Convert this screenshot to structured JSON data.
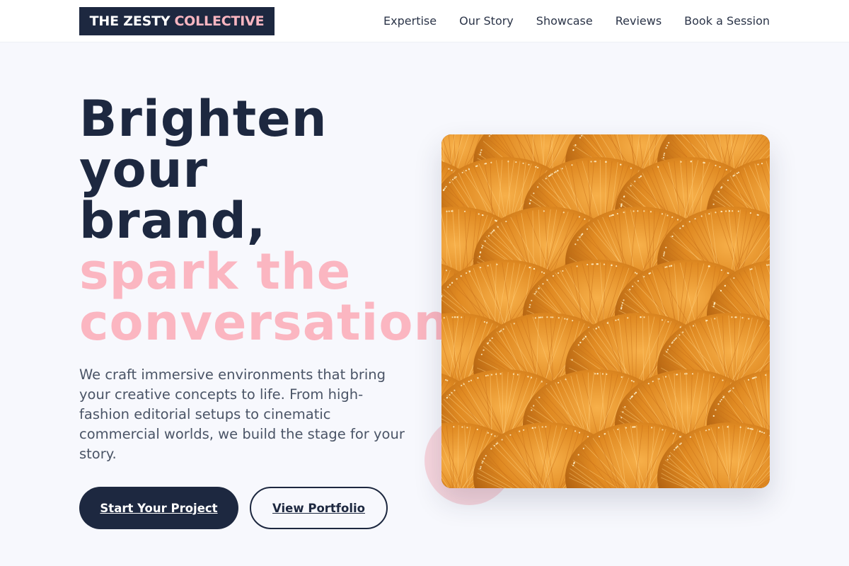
{
  "header": {
    "logo_main": "THE ZESTY",
    "logo_accent": "COLLECTIVE",
    "nav": [
      {
        "label": "Expertise"
      },
      {
        "label": "Our Story"
      },
      {
        "label": "Showcase"
      },
      {
        "label": "Reviews"
      },
      {
        "label": "Book a Session"
      }
    ]
  },
  "hero": {
    "headline_lines": [
      "Brighten",
      "your",
      "brand,"
    ],
    "headline_accent_lines": [
      "spark the",
      "conversation."
    ],
    "description": "We craft immersive environments that bring your creative concepts to life. From high-fashion editorial setups to cinematic commercial worlds, we build the stage for your story.",
    "primary_cta": "Start Your Project",
    "secondary_cta": "View Portfolio",
    "image": "orange bristle bundles photo"
  },
  "colors": {
    "navy": "#1d2840",
    "pink": "#fbb6c1",
    "background": "#f7f8fd",
    "orange": "#d98a1f"
  }
}
